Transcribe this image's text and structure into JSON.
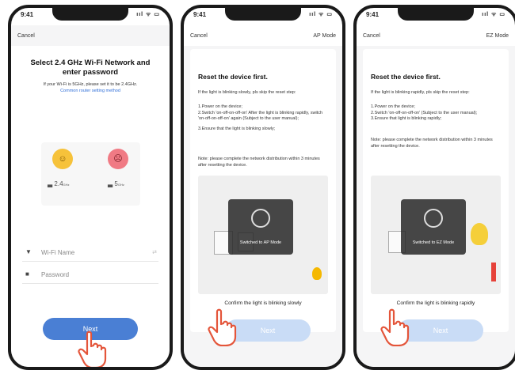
{
  "phones": [
    {
      "time": "9:41",
      "status_icons": "ııl ᯤ ▭",
      "cancel": "Cancel",
      "title_line1": "Select 2.4 GHz Wi-Fi Network and",
      "title_line2": "enter password",
      "hint": "If your Wi-Fi is 5GHz, please set it to be 2.4GHz.",
      "link": "Common router setting method",
      "band_ok": "2.4",
      "band_bad": "5",
      "band_unit": "GHz",
      "wifi_placeholder": "Wi-Fi Name",
      "password_placeholder": "Password",
      "button": "Next",
      "colors": {
        "button": "#4a7fd4",
        "ok_face": "#f6c23a",
        "bad_face": "#f07a84"
      }
    },
    {
      "time": "9:41",
      "status_icons": "ııl ᯤ ▭",
      "cancel": "Cancel",
      "mode": "AP Mode",
      "title": "Reset the device first.",
      "intro": "If the light is blinking slowly, pls skip the reset step:",
      "steps": [
        "1.Power on the device;",
        "2.Switch 'on-off-on-off-on' After the light is blinking rapidly, switch 'on-off-on-off-on' again (Subject to the user manual);",
        "3.Ensure that the light is blinking slowly;"
      ],
      "note": "Note: please complete the network distribution within 3 minutes after resetting the device.",
      "toast": "Switched to AP Mode",
      "confirm": "Confirm the light is blinking slowly",
      "button": "Next",
      "colors": {
        "button": "#c9dcf6"
      }
    },
    {
      "time": "9:41",
      "status_icons": "ııl ᯤ ▭",
      "cancel": "Cancel",
      "mode": "EZ Mode",
      "title": "Reset the device first.",
      "intro": "If the light is blinking rapidly, pls skip the reset step:",
      "steps": [
        "1.Power on the device;",
        "2.Switch 'on-off-on-off-on' (Subject to the user manual);",
        "3.Ensure that light is blinking rapidly;"
      ],
      "note": "Note: please complete the network distribution within 3 minutes after resetting the device.",
      "toast": "Switched to EZ Mode",
      "confirm": "Confirm the light is blinking rapidly",
      "button": "Next",
      "colors": {
        "button": "#c9dcf6"
      }
    }
  ]
}
